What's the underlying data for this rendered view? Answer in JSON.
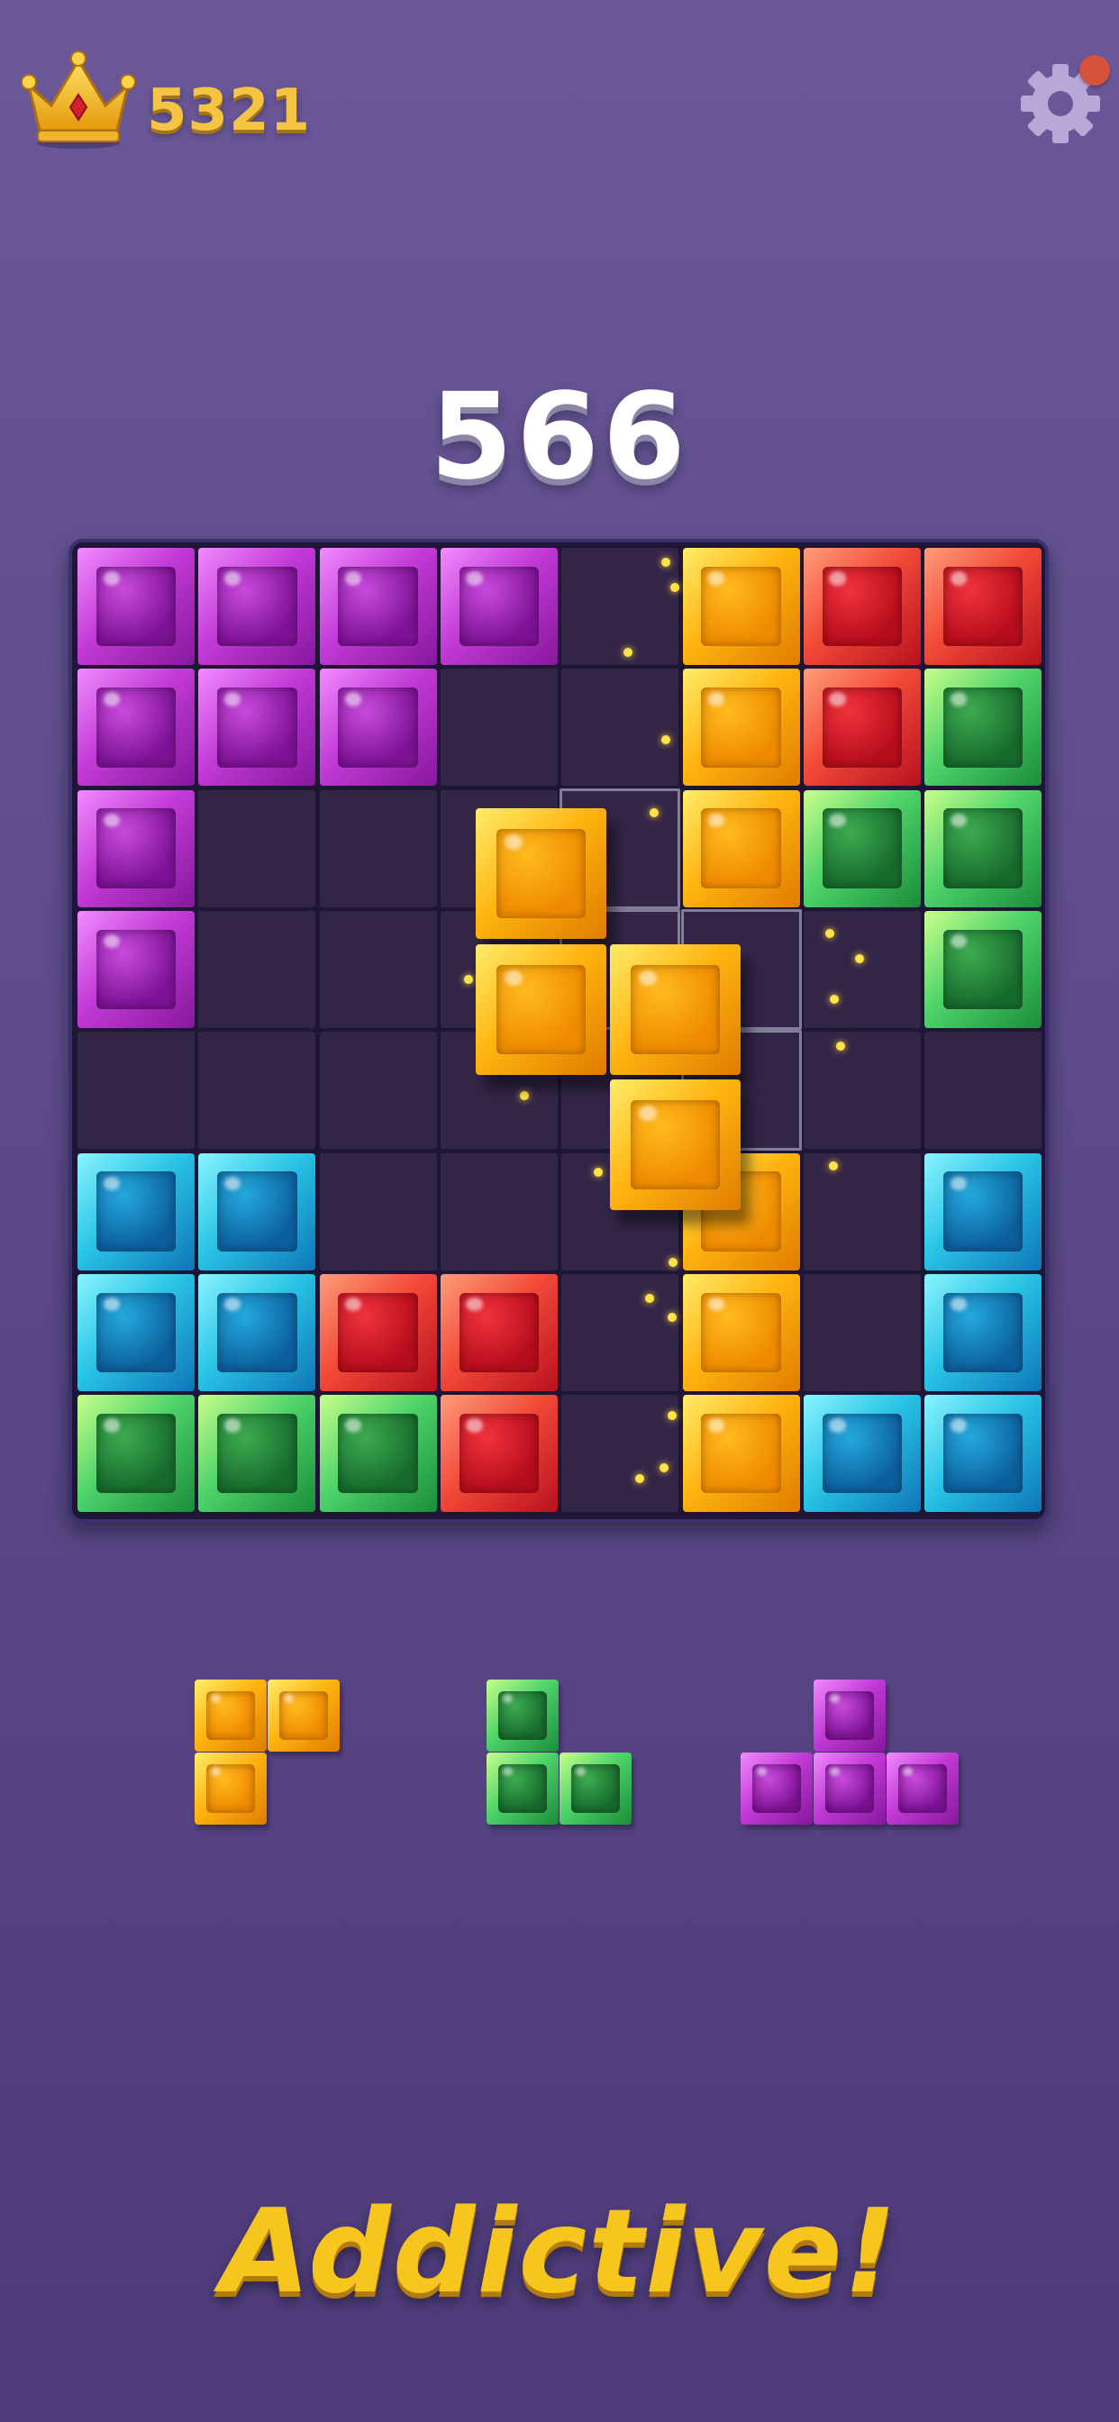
{
  "header": {
    "best_score": "5321",
    "crown_icon": "crown-icon",
    "settings_icon": "gear-icon",
    "notification": true
  },
  "current_score": "566",
  "board": {
    "rows": 8,
    "cols": 8,
    "grid": [
      [
        "purple",
        "purple",
        "purple",
        "purple",
        null,
        "orange",
        "red",
        "red"
      ],
      [
        "purple",
        "purple",
        "purple",
        null,
        null,
        "orange",
        "red",
        "green"
      ],
      [
        "purple",
        null,
        null,
        null,
        null,
        "orange",
        "green",
        "green"
      ],
      [
        "purple",
        null,
        null,
        null,
        null,
        null,
        null,
        "green"
      ],
      [
        null,
        null,
        null,
        null,
        null,
        null,
        null,
        null
      ],
      [
        "cyan",
        "cyan",
        null,
        null,
        null,
        "orange",
        null,
        "cyan"
      ],
      [
        "cyan",
        "cyan",
        "red",
        "red",
        null,
        "orange",
        null,
        "cyan"
      ],
      [
        "green",
        "green",
        "green",
        "red",
        null,
        "orange",
        "cyan",
        "cyan"
      ]
    ],
    "drag_piece": {
      "color": "orange",
      "shape": "S-vertical",
      "drop_preview": [
        [
          2,
          4
        ],
        [
          3,
          4
        ],
        [
          3,
          5
        ],
        [
          4,
          5
        ]
      ]
    }
  },
  "tray": [
    {
      "color": "orange",
      "shape": "L-corner"
    },
    {
      "color": "green",
      "shape": "L"
    },
    {
      "color": "purple",
      "shape": "T"
    }
  ],
  "colors": {
    "background": "#5c4a8a",
    "board": "#1f1637",
    "score_gold": "#f6c443"
  },
  "slogan": "Addictive!"
}
